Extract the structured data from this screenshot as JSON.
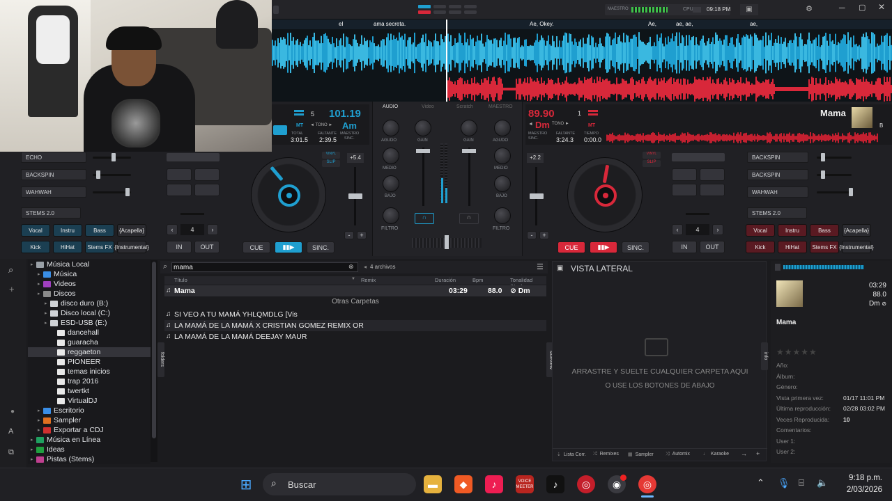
{
  "topbar": {
    "master_label": "MAESTRO",
    "cpu_label": "CPU",
    "clock": "09:18 PM"
  },
  "lyrics": [
    "el",
    "ama secreta.",
    "Ae, Okey.",
    "Ae,",
    "ae, ae,",
    "ae,"
  ],
  "deck_left": {
    "deck_num": "5",
    "bpm": "101.19",
    "key_mode": "MT",
    "key_label": "TONO",
    "key": "Am",
    "total_label": "TOTAL",
    "total": "3:01.5",
    "remain_label": "FALTANTE",
    "remain": "2:39.5",
    "master_label": "MAESTRO",
    "sync_label": "SINC.",
    "pitch": "+5.4",
    "vinyl": "VINYL",
    "slip": "SLIP",
    "cue": "CUE",
    "sync": "SINC.",
    "loop": "4",
    "in": "IN",
    "out": "OUT",
    "fx": [
      "ECHO",
      "BACKSPIN",
      "WAHWAH"
    ],
    "stems_select": "STEMS 2.0",
    "stems": [
      "Vocal",
      "Instru",
      "Bass",
      "{Acapella}",
      "Kick",
      "HiHat",
      "Stems FX",
      "{Instrumental}"
    ]
  },
  "deck_right": {
    "bpm": "89.90",
    "deck_num": "1",
    "key": "Dm",
    "key_mode": "MT",
    "key_label": "TONO",
    "master_label": "MAESTRO",
    "sync_label": "SINC.",
    "remain_label": "FALTANTE",
    "remain": "3:24.3",
    "time_label": "TIEMPO",
    "time": "0:00.0",
    "title": "Mama",
    "deck_letter": "B",
    "pitch": "+2.2",
    "vinyl": "VINYL",
    "slip": "SLIP",
    "cue": "CUE",
    "sync": "SINC.",
    "loop": "4",
    "in": "IN",
    "out": "OUT",
    "fx": [
      "BACKSPIN",
      "BACKSPIN",
      "WAHWAH"
    ],
    "stems_select": "STEMS 2.0",
    "stems": [
      "Vocal",
      "Instru",
      "Bass",
      "{Acapella}",
      "Kick",
      "HiHat",
      "Stems FX",
      "{Instrumental}"
    ]
  },
  "mixer": {
    "tabs": [
      "AUDIO",
      "Video",
      "Scratch",
      "MAESTRO"
    ],
    "agudo": "AGUDO",
    "medio": "MEDIO",
    "bajo": "BAJO",
    "filtro": "FILTRO",
    "gain": "GAIN"
  },
  "tree": [
    {
      "label": "Música Local",
      "indent": 0,
      "color": "#9aa0a6"
    },
    {
      "label": "Música",
      "indent": 1,
      "color": "#3a8ee6"
    },
    {
      "label": "Videos",
      "indent": 1,
      "color": "#a040c0"
    },
    {
      "label": "Discos",
      "indent": 1,
      "color": "#8a8a8a"
    },
    {
      "label": "disco duro (B:)",
      "indent": 2,
      "color": "#cfd2d6"
    },
    {
      "label": "Disco local (C:)",
      "indent": 2,
      "color": "#cfd2d6"
    },
    {
      "label": "ESD-USB (E:)",
      "indent": 2,
      "color": "#cfd2d6"
    },
    {
      "label": "dancehall",
      "indent": 3,
      "color": "#e8e8e8"
    },
    {
      "label": "guaracha",
      "indent": 3,
      "color": "#e8e8e8"
    },
    {
      "label": "reggaeton",
      "indent": 3,
      "color": "#e8e8e8",
      "selected": true
    },
    {
      "label": "PIONEER",
      "indent": 3,
      "color": "#e8e8e8"
    },
    {
      "label": "temas inicios",
      "indent": 3,
      "color": "#e8e8e8"
    },
    {
      "label": "trap 2016",
      "indent": 3,
      "color": "#e8e8e8"
    },
    {
      "label": "twertkt",
      "indent": 3,
      "color": "#e8e8e8"
    },
    {
      "label": "VirtualDJ",
      "indent": 3,
      "color": "#e8e8e8"
    },
    {
      "label": "Escritorio",
      "indent": 1,
      "color": "#3a8ee6"
    },
    {
      "label": "Sampler",
      "indent": 1,
      "color": "#e07020"
    },
    {
      "label": "Exportar a CDJ",
      "indent": 1,
      "color": "#d03030"
    },
    {
      "label": "Música en Línea",
      "indent": 0,
      "color": "#20a060"
    },
    {
      "label": "Ideas",
      "indent": 0,
      "color": "#20a040"
    },
    {
      "label": "Pistas (Stems)",
      "indent": 0,
      "color": "#c04090"
    }
  ],
  "search": {
    "value": "mama",
    "count": "4 archivos"
  },
  "columns": [
    "Título",
    "Remix",
    "Duración",
    "Bpm",
    "Tonalidad (Key)"
  ],
  "tracks": [
    {
      "title": "Mama",
      "duration": "03:29",
      "bpm": "88.0",
      "key": "Dm"
    }
  ],
  "other_folders_label": "Otras Carpetas",
  "other_tracks": [
    "SI VEO A TU MAMÁ   YHLQMDLG [Vis",
    "LA MAMÁ DE LA MAMÁ X CRISTIAN GOMEZ REMIX OR",
    "LA MAMÁ DE LA MAMÁ  DEEJAY MAUR"
  ],
  "side_tabs": {
    "folders": "folders",
    "sideview": "sideview",
    "info": "info"
  },
  "sideview": {
    "title": "VISTA LATERAL",
    "drop1": "ARRASTRE Y SUELTE CUALQUIER CARPETA AQUI",
    "drop2": "O USE LOS BOTONES DE ABAJO",
    "buttons": [
      "Lista Corr.",
      "Remixes",
      "Sampler",
      "Automix",
      "Karaoke"
    ]
  },
  "info": {
    "duration": "03:29",
    "bpm": "88.0",
    "key": "Dm",
    "title": "Mama",
    "fields": [
      {
        "k": "Año:",
        "v": ""
      },
      {
        "k": "Álbum:",
        "v": ""
      },
      {
        "k": "Género:",
        "v": ""
      },
      {
        "k": "Vista primera vez:",
        "v": "01/17 11:01 PM"
      },
      {
        "k": "Última reproducción:",
        "v": "02/28 03:02 PM"
      },
      {
        "k": "Veces Reproducida:",
        "v": "10"
      },
      {
        "k": "Comentarios:",
        "v": ""
      },
      {
        "k": "User 1:",
        "v": ""
      },
      {
        "k": "User 2:",
        "v": ""
      }
    ]
  },
  "taskbar": {
    "search_placeholder": "Buscar",
    "time": "9:18 p.m.",
    "date": "2/03/2026",
    "voice_label": "VOICE",
    "voice_sub": "MEETER"
  },
  "colors": {
    "blue": "#1f9fd0",
    "red": "#d8283a",
    "bg": "#202024"
  }
}
